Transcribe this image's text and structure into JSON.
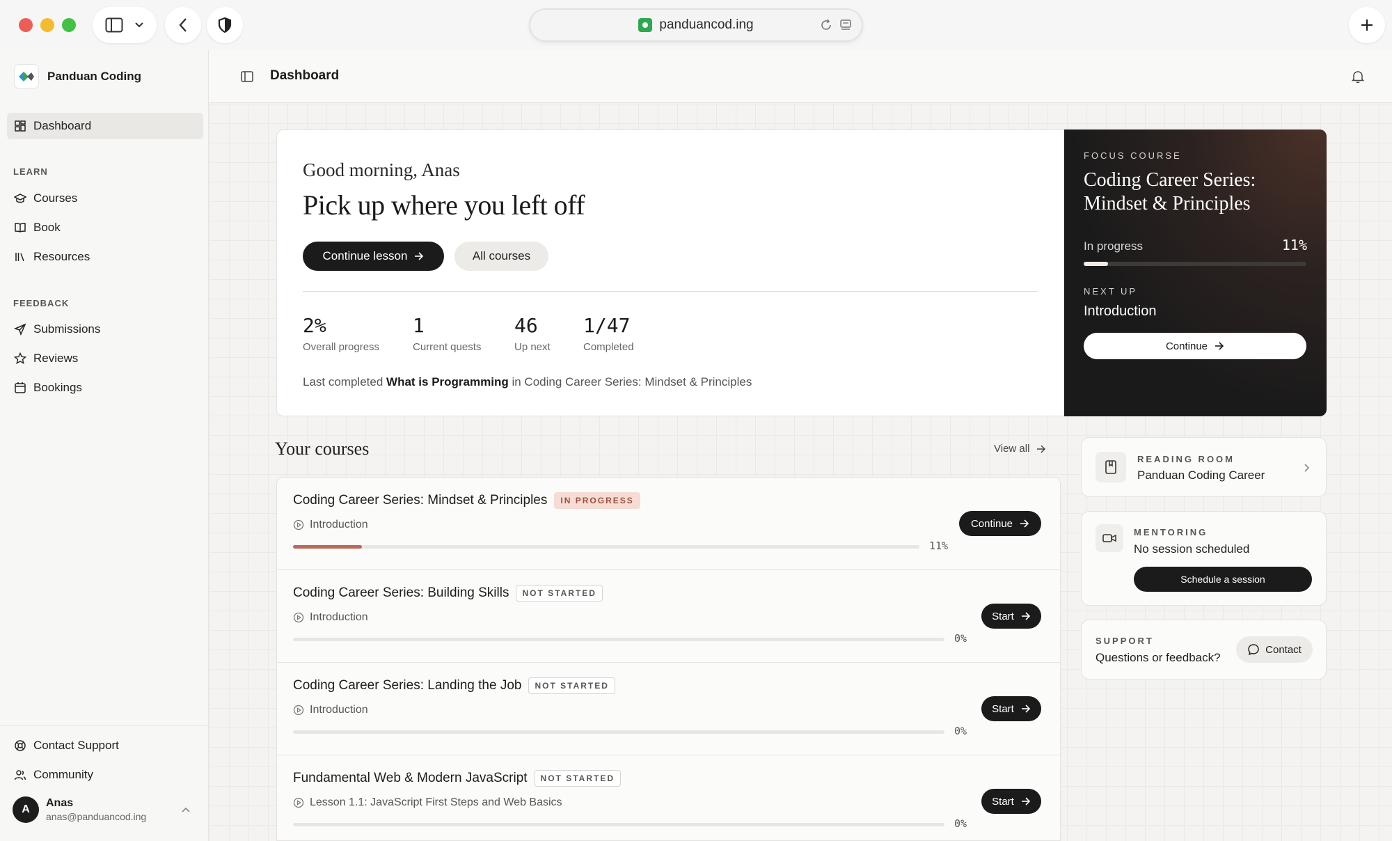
{
  "browser": {
    "url": "panduancod.ing"
  },
  "sidebar": {
    "brand": "Panduan Coding",
    "active_item": "Dashboard",
    "section_learn": "LEARN",
    "learn_items": [
      "Courses",
      "Book",
      "Resources"
    ],
    "section_feedback": "FEEDBACK",
    "feedback_items": [
      "Submissions",
      "Reviews",
      "Bookings"
    ],
    "bottom_items": [
      "Contact Support",
      "Community"
    ],
    "user": {
      "initial": "A",
      "name": "Anas",
      "email": "anas@panduancod.ing"
    }
  },
  "topbar": {
    "title": "Dashboard"
  },
  "hero": {
    "greeting": "Good morning, Anas",
    "title": "Pick up where you left off",
    "primary_button": "Continue lesson",
    "secondary_button": "All courses",
    "stats": [
      {
        "value": "2%",
        "label": "Overall progress"
      },
      {
        "value": "1",
        "label": "Current quests"
      },
      {
        "value": "46",
        "label": "Up next"
      },
      {
        "value": "1/47",
        "label": "Completed"
      }
    ],
    "last_completed_prefix": "Last completed",
    "last_completed_lesson": "What is Programming",
    "last_completed_in": "in",
    "last_completed_course": "Coding Career Series: Mindset & Principles"
  },
  "focus": {
    "eyebrow": "FOCUS COURSE",
    "title": "Coding Career Series: Mindset & Principles",
    "progress_label": "In progress",
    "progress_value": "11%",
    "progress_fraction": 0.11,
    "next_label": "NEXT UP",
    "next_lesson": "Introduction",
    "button": "Continue"
  },
  "courses": {
    "section_title": "Your courses",
    "view_all": "View all",
    "items": [
      {
        "title": "Coding Career Series: Mindset & Principles",
        "badge": "IN PROGRESS",
        "lesson": "Introduction",
        "percent": "11%",
        "progress": 0.11,
        "button": "Continue"
      },
      {
        "title": "Coding Career Series: Building Skills",
        "badge": "NOT STARTED",
        "lesson": "Introduction",
        "percent": "0%",
        "progress": 0,
        "button": "Start"
      },
      {
        "title": "Coding Career Series: Landing the Job",
        "badge": "NOT STARTED",
        "lesson": "Introduction",
        "percent": "0%",
        "progress": 0,
        "button": "Start"
      },
      {
        "title": "Fundamental Web & Modern JavaScript",
        "badge": "NOT STARTED",
        "lesson": "Lesson 1.1: JavaScript First Steps and Web Basics",
        "percent": "0%",
        "progress": 0,
        "button": "Start"
      }
    ]
  },
  "reading_room": {
    "eyebrow": "READING ROOM",
    "text": "Panduan Coding Career"
  },
  "mentoring": {
    "eyebrow": "MENTORING",
    "text": "No session scheduled",
    "button": "Schedule a session"
  },
  "support": {
    "eyebrow": "SUPPORT",
    "text": "Questions or feedback?",
    "button": "Contact"
  },
  "colors": {
    "accent_progress": "#b86a56",
    "badge_in_progress_bg": "#f6dcd4",
    "dark": "#1b1b1b"
  }
}
